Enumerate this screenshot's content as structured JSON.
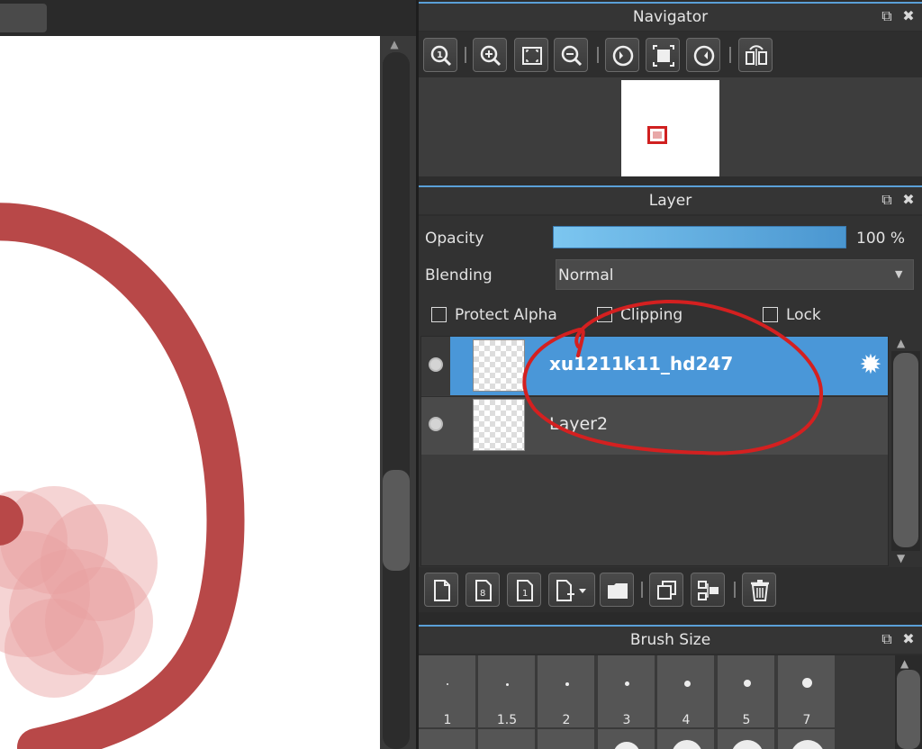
{
  "navigator": {
    "title": "Navigator",
    "tools": [
      "zoom-actual-icon",
      "zoom-in-icon",
      "fit-icon",
      "zoom-out-icon",
      "rotate-left-icon",
      "fit-window-icon",
      "rotate-right-icon",
      "flip-icon"
    ]
  },
  "layer": {
    "title": "Layer",
    "opacity_label": "Opacity",
    "opacity_value": "100 %",
    "opacity_fraction": 1.0,
    "blending_label": "Blending",
    "blending_value": "Normal",
    "protect_alpha_label": "Protect Alpha",
    "clipping_label": "Clipping",
    "lock_label": "Lock",
    "layers": [
      {
        "name": "xu1211k11_hd247",
        "selected": true
      },
      {
        "name": "Layer2",
        "selected": false
      }
    ],
    "tools": [
      "new-layer-icon",
      "new-8bit-layer-icon",
      "new-1bit-layer-icon",
      "add-layer-menu-icon",
      "folder-icon",
      "duplicate-icon",
      "merge-icon",
      "delete-icon"
    ]
  },
  "brush_size": {
    "title": "Brush Size",
    "sizes": [
      "1",
      "1.5",
      "2",
      "3",
      "4",
      "5",
      "7"
    ]
  },
  "colors": {
    "accent": "#4a97d8",
    "annotation": "#d42020",
    "stroke": "#b84848"
  }
}
